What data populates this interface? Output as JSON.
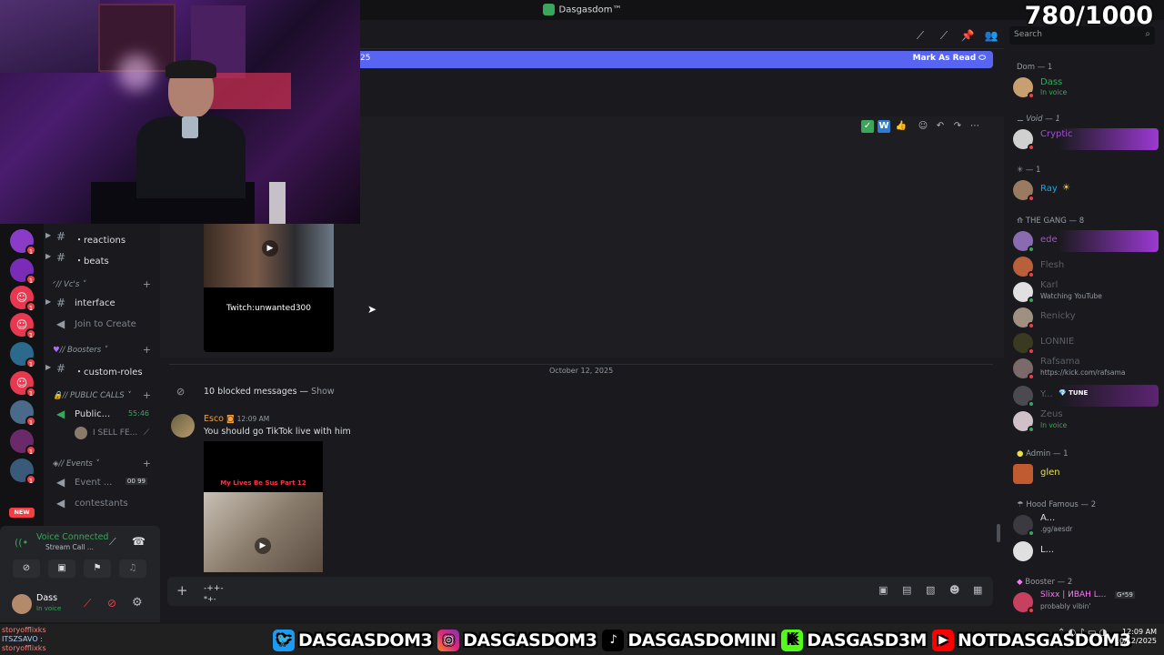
{
  "window": {
    "title": "Dasgasdom™"
  },
  "overlay": {
    "counter": "780/1000"
  },
  "header": {
    "search_placeholder": "Search"
  },
  "banner": {
    "text": "25",
    "mark_as_read": "Mark As Read"
  },
  "channels": [
    {
      "name": "・reactions",
      "type": "text"
    },
    {
      "name": "・beats",
      "type": "text"
    },
    {
      "category": "// Vc's"
    },
    {
      "name": "interface",
      "type": "text"
    },
    {
      "name": "Join to Create",
      "type": "voice"
    },
    {
      "category": "// Boosters"
    },
    {
      "name": "・custom-roles",
      "type": "text"
    },
    {
      "category": "// PUBLIC CALLS"
    },
    {
      "name": "Public...",
      "type": "voice",
      "time": "55:46"
    },
    {
      "name": "I SELL FE...",
      "type": "user"
    },
    {
      "category": "// Events"
    },
    {
      "name": "Event ...",
      "type": "voice",
      "counts": [
        "00",
        "99"
      ]
    },
    {
      "name": "contestants",
      "type": "voice"
    }
  ],
  "voice_panel": {
    "status": "Voice Connected",
    "sub": "Stream Call ...",
    "user": "Dass",
    "user_status": "In voice"
  },
  "messages": {
    "video_caption": "Twitch:unwanted300",
    "date_divider": "October 12, 2025",
    "blocked": "10 blocked messages — ",
    "blocked_show": "Show",
    "author": "Esco",
    "time": "12:09 AM",
    "text": "You should go TikTok live with him",
    "thumb_caption": "My Lives Be Sus Part 12"
  },
  "composer": {
    "text": "-++-",
    "text2": "*+-"
  },
  "members": {
    "groups": [
      {
        "header": "Dom — 1",
        "members": [
          {
            "name": "Dass",
            "sub": "In voice",
            "color": "#3ba55c"
          }
        ]
      },
      {
        "header": "Void — 1",
        "members": [
          {
            "name": "Cryptic",
            "sub": "",
            "color": "#a84ce0"
          }
        ]
      },
      {
        "header": "— 1",
        "members": [
          {
            "name": "Ray",
            "sub": "",
            "color": "#00b0f4"
          }
        ]
      },
      {
        "header": "THE GANG — 8",
        "members": [
          {
            "name": "ede",
            "sub": "",
            "color": "#a84ce0"
          },
          {
            "name": "Flesh",
            "sub": "",
            "color": "#5c5f66"
          },
          {
            "name": "Karl",
            "sub": "Watching YouTube",
            "color": "#5c5f66"
          },
          {
            "name": "Renicky",
            "sub": "",
            "color": "#5c5f66"
          },
          {
            "name": "LONNIE",
            "sub": "",
            "color": "#5c5f66"
          },
          {
            "name": "Rafsama",
            "sub": "https://kick.com/rafsama",
            "color": "#5c5f66"
          },
          {
            "name": "Y...",
            "sub": "",
            "color": "#5c5f66",
            "tag": "TUNE"
          },
          {
            "name": "Zeus",
            "sub": "In voice",
            "color": "#5c5f66"
          }
        ]
      },
      {
        "header": "Admin — 1",
        "members": [
          {
            "name": "glen",
            "sub": "",
            "color": "#e8e04a"
          }
        ]
      },
      {
        "header": "Hood Famous — 2",
        "members": [
          {
            "name": "A...",
            "sub": ".gg/aesdr",
            "color": "#dbdee1"
          },
          {
            "name": "L...",
            "sub": "",
            "color": "#dbdee1"
          }
        ]
      },
      {
        "header": "Booster — 2",
        "members": [
          {
            "name": "Slixx | ИВАН L...",
            "sub": "probably vibin'",
            "color": "#ff73fa",
            "tag": "G*59"
          }
        ]
      }
    ]
  },
  "socials": [
    {
      "icon": "twitter-icon",
      "handle": "DASGASDOM3"
    },
    {
      "icon": "instagram-icon",
      "handle": "DASGASDOM3"
    },
    {
      "icon": "tiktok-icon",
      "handle": "DASGASDOMINI"
    },
    {
      "icon": "kick-icon",
      "handle": "DASGASD3M"
    },
    {
      "icon": "youtube-icon",
      "handle": "NOTDASGASDOM3"
    }
  ],
  "chat_overlay": {
    "line1": "storyofflixks",
    "line2": "ITSZSAVO :",
    "line3": "storyofflixks"
  },
  "tray": {
    "time": "12:09 AM",
    "date": "10/12/2025"
  }
}
